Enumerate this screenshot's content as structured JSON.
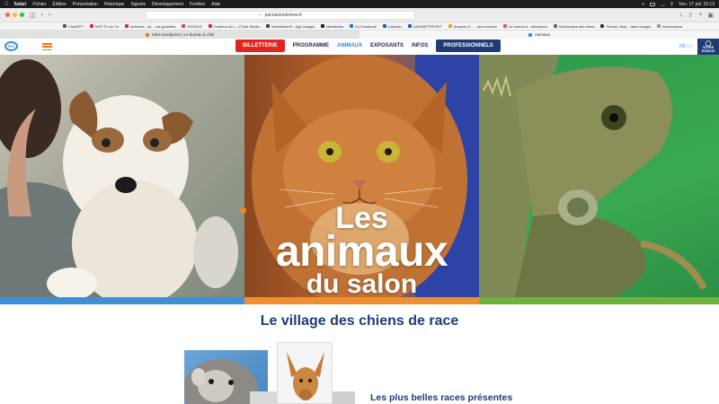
{
  "menubar": {
    "app": "Safari",
    "items": [
      "Fichier",
      "Édition",
      "Présentation",
      "Historique",
      "Signets",
      "Développement",
      "Fenêtre",
      "Aide"
    ],
    "datetime": "Ven. 17 juil.  15:13"
  },
  "browser": {
    "address": "parisanimalshow.fr",
    "bookmarks": [
      "ChatGPT",
      "NYR Tv sur Yo",
      "redmonk - ok... ces gratuites",
      "SOGELE",
      "Contenu de L...//Tube Studio",
      "Velvetbleue® - Agir Images",
      "Mertiander",
      "(1) Facebook",
      "Linkedin",
      "LINONETPROFIT",
      "Amazon.fr - ... ateur electrc",
      "Le bureau d - démission",
      "Dictionnaire des rimes",
      "Photos, illust... tales images",
      "Informations"
    ],
    "tabs": [
      {
        "label": "Sites wordpress | Le bureau à côté",
        "active": false
      },
      {
        "label": "Animaux",
        "active": true
      }
    ]
  },
  "site": {
    "logo_text": "PAS",
    "nav": {
      "billetterie": "BILLETTERIE",
      "programme": "PROGRAMME",
      "animaux": "ANIMAUX",
      "exposants": "EXPOSANTS",
      "infos": "INFOS",
      "professionnels": "PROFESSIONNELS"
    },
    "lang": {
      "fr": "FR",
      "en": "EN"
    },
    "votre_espace": "VOTRE ESPACE",
    "hero": {
      "line1": "Les",
      "line2": "animaux",
      "line3": "du salon"
    },
    "section_title": "Le village des chiens de race",
    "sub_title": "Les plus belles races présentes"
  },
  "colors": {
    "navy": "#1e3c78",
    "red": "#e3231c",
    "blue_bar": "#3d90d8",
    "orange_bar": "#ef8f2f",
    "green_bar": "#6db23b",
    "accent_blue": "#2f86d6"
  }
}
